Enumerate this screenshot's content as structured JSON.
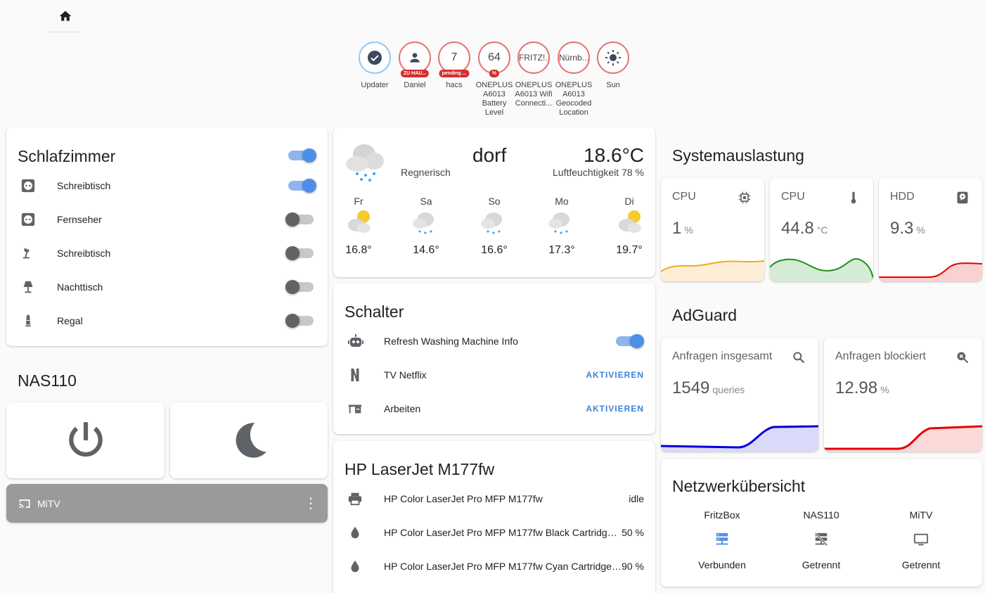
{
  "badges": [
    {
      "value": "",
      "pill": "",
      "label": "Updater"
    },
    {
      "value": "",
      "pill": "ZU HAU...",
      "label": "Daniel"
    },
    {
      "value": "7",
      "pill": "pending ...",
      "label": "hacs"
    },
    {
      "value": "64",
      "pill": "%",
      "label": "ONEPLUS A6013 Battery Level"
    },
    {
      "value": "FRITZ!...",
      "pill": "",
      "label": "ONEPLUS A6013 Wifi Connecti..."
    },
    {
      "value": "Nürnb...",
      "pill": "",
      "label": "ONEPLUS A6013 Geocoded Location"
    },
    {
      "value": "",
      "pill": "",
      "label": "Sun"
    }
  ],
  "schlafzimmer": {
    "title": "Schlafzimmer",
    "items": [
      {
        "name": "Schreibtisch",
        "icon": "power-socket-icon",
        "on": true
      },
      {
        "name": "Fernseher",
        "icon": "power-socket-icon",
        "on": false
      },
      {
        "name": "Schreibtisch",
        "icon": "desk-lamp-icon",
        "on": false
      },
      {
        "name": "Nachttisch",
        "icon": "floor-lamp-icon",
        "on": false
      },
      {
        "name": "Regal",
        "icon": "lamp-icon",
        "on": false
      }
    ]
  },
  "nas": {
    "title": "NAS110",
    "media_name": "MiTV"
  },
  "weather": {
    "location": "dorf",
    "condition": "Regnerisch",
    "temperature": "18.6°C",
    "humidity": "Luftfeuchtigkeit 78 %",
    "forecast": [
      {
        "day": "Fr",
        "temp": "16.8°",
        "icon": "partly-cloudy-icon"
      },
      {
        "day": "Sa",
        "temp": "14.6°",
        "icon": "rainy-icon"
      },
      {
        "day": "So",
        "temp": "16.6°",
        "icon": "rainy-icon"
      },
      {
        "day": "Mo",
        "temp": "17.3°",
        "icon": "rainy-icon"
      },
      {
        "day": "Di",
        "temp": "19.7°",
        "icon": "partly-cloudy-icon"
      }
    ]
  },
  "schalter": {
    "title": "Schalter",
    "items": [
      {
        "name": "Refresh Washing Machine Info",
        "action": ""
      },
      {
        "name": "TV Netflix",
        "action": "AKTIVIEREN"
      },
      {
        "name": "Arbeiten",
        "action": "AKTIVIEREN"
      }
    ]
  },
  "printer": {
    "title": "HP LaserJet M177fw",
    "items": [
      {
        "name": "HP Color LaserJet Pro MFP M177fw",
        "value": "idle"
      },
      {
        "name": "HP Color LaserJet Pro MFP M177fw Black Cartridge ...",
        "value": "50 %"
      },
      {
        "name": "HP Color LaserJet Pro MFP M177fw Cyan Cartridge ...",
        "value": "90 %"
      }
    ]
  },
  "system": {
    "title": "Systemauslastung",
    "sensors": [
      {
        "name": "CPU",
        "value": "1",
        "unit": "%",
        "color": "#f5a623"
      },
      {
        "name": "CPU",
        "value": "44.8",
        "unit": "°C",
        "color": "#1e8e1e"
      },
      {
        "name": "HDD",
        "value": "9.3",
        "unit": "%",
        "color": "#e50000"
      }
    ]
  },
  "adguard": {
    "title": "AdGuard",
    "sensors": [
      {
        "name": "Anfragen insgesamt",
        "value": "1549",
        "unit": "queries",
        "color": "#0000d6"
      },
      {
        "name": "Anfragen blockiert",
        "value": "12.98",
        "unit": "%",
        "color": "#e50000"
      }
    ]
  },
  "network": {
    "title": "Netzwerkübersicht",
    "devices": [
      {
        "name": "FritzBox",
        "status": "Verbunden"
      },
      {
        "name": "NAS110",
        "status": "Getrennt"
      },
      {
        "name": "MiTV",
        "status": "Getrennt"
      }
    ]
  },
  "colors": {
    "accent": "#4d8ee9",
    "danger": "#d32f2f",
    "icon": "#5f6368"
  }
}
